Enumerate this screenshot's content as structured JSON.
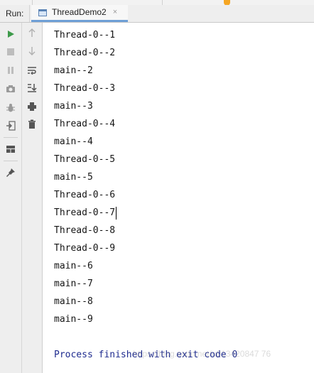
{
  "tool_window": {
    "run_label": "Run:",
    "tab": {
      "title": "ThreadDemo2",
      "close_glyph": "×",
      "icon": "run-config-icon"
    }
  },
  "left_toolbar": [
    {
      "name": "rerun-icon",
      "color": "#3d9a4a"
    },
    {
      "name": "stop-icon",
      "color": "#bdbdbd"
    },
    {
      "name": "pause-icon",
      "color": "#bdbdbd"
    },
    {
      "name": "camera-icon",
      "color": "#9a9a9a"
    },
    {
      "name": "debug-icon",
      "color": "#9a9a9a"
    },
    {
      "name": "exit-icon",
      "color": "#666666"
    },
    {
      "name": "layout-icon",
      "color": "#555555"
    },
    {
      "name": "pin-icon",
      "color": "#555555"
    }
  ],
  "right_toolbar": [
    {
      "name": "up-arrow-icon",
      "color": "#b0b0b0"
    },
    {
      "name": "down-arrow-icon",
      "color": "#b0b0b0"
    },
    {
      "name": "soft-wrap-icon",
      "color": "#555555"
    },
    {
      "name": "scroll-to-end-icon",
      "color": "#555555"
    },
    {
      "name": "print-icon",
      "color": "#555555"
    },
    {
      "name": "trash-icon",
      "color": "#555555"
    }
  ],
  "console": {
    "lines": [
      "Thread-0--1",
      "Thread-0--2",
      "main--2",
      "Thread-0--3",
      "main--3",
      "Thread-0--4",
      "main--4",
      "Thread-0--5",
      "main--5",
      "Thread-0--6",
      "Thread-0--7",
      "Thread-0--8",
      "Thread-0--9",
      "main--6",
      "main--7",
      "main--8",
      "main--9"
    ],
    "finished_message": "Process finished with exit code 0",
    "text_color": "#151515",
    "finished_color": "#1e2b8f"
  },
  "watermark": "https://blog.csdn.net/u013420847 76"
}
